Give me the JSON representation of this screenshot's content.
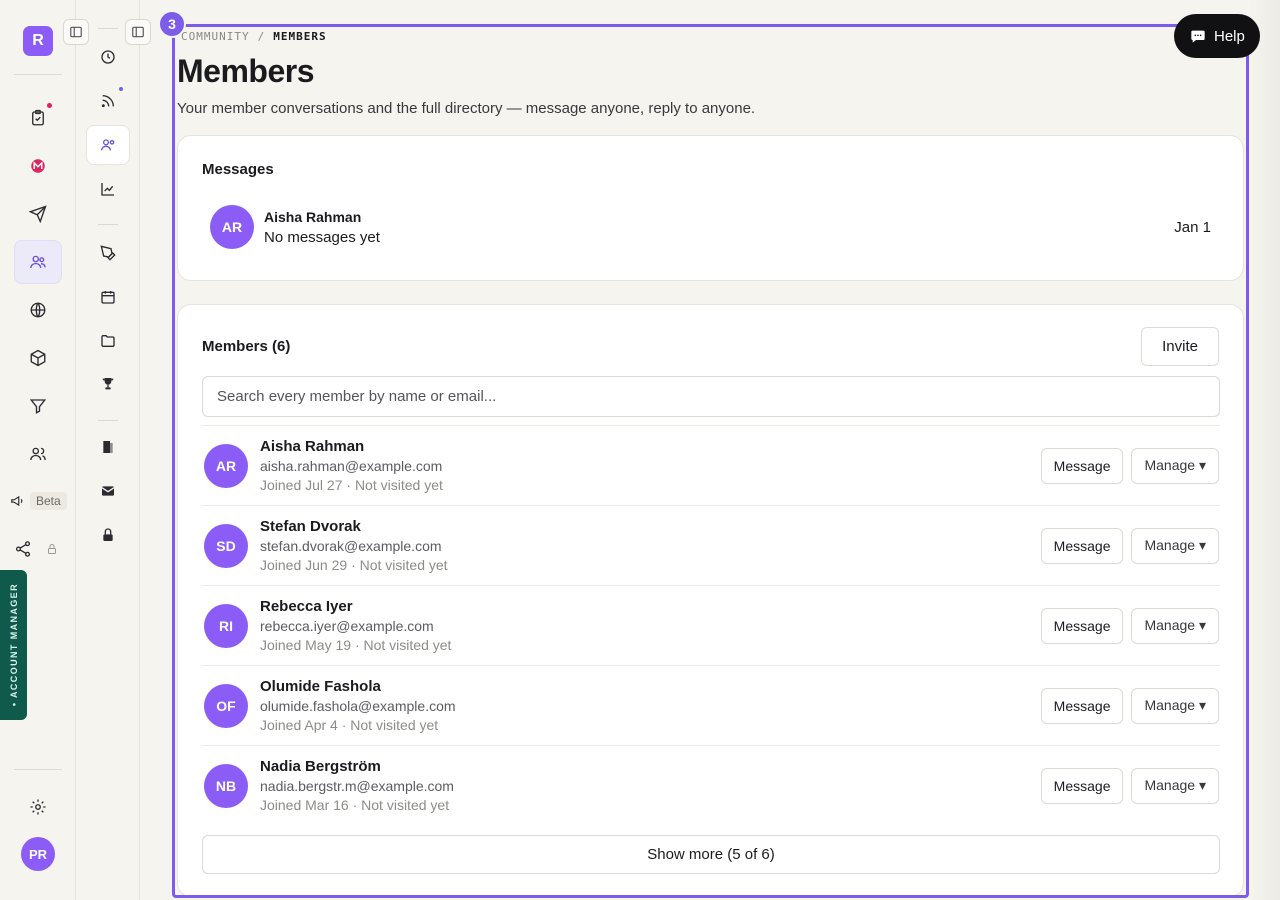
{
  "rail": {
    "logo": "R",
    "beta_label": "Beta",
    "account_manager": "• ACCOUNT MANAGER",
    "user_initials": "PR"
  },
  "breadcrumb": {
    "parent": "COMMUNITY",
    "separator": "/",
    "current": "MEMBERS"
  },
  "page": {
    "title": "Members",
    "subtitle": "Your member conversations and the full directory — message anyone, reply to anyone."
  },
  "step_badge": "3",
  "help": {
    "label": "Help"
  },
  "messages": {
    "title": "Messages",
    "items": [
      {
        "initials": "AR",
        "name": "Aisha Rahman",
        "preview": "No messages yet",
        "date": "Jan 1"
      }
    ]
  },
  "members": {
    "title": "Members (6)",
    "invite_label": "Invite",
    "search_placeholder": "Search every member by name or email...",
    "message_label": "Message",
    "manage_label": "Manage ▾",
    "show_more_label": "Show more (5 of 6)",
    "rows": [
      {
        "initials": "AR",
        "name": "Aisha Rahman",
        "email": "aisha.rahman@example.com",
        "meta": "Joined Jul 27 · Not visited yet"
      },
      {
        "initials": "SD",
        "name": "Stefan Dvorak",
        "email": "stefan.dvorak@example.com",
        "meta": "Joined Jun 29 · Not visited yet"
      },
      {
        "initials": "RI",
        "name": "Rebecca Iyer",
        "email": "rebecca.iyer@example.com",
        "meta": "Joined May 19 · Not visited yet"
      },
      {
        "initials": "OF",
        "name": "Olumide Fashola",
        "email": "olumide.fashola@example.com",
        "meta": "Joined Apr 4 · Not visited yet"
      },
      {
        "initials": "NB",
        "name": "Nadia Bergström",
        "email": "nadia.bergstr.m@example.com",
        "meta": "Joined Mar 16 · Not visited yet"
      }
    ]
  },
  "colors": {
    "accent": "#8b5cf6",
    "highlight_border": "#7c5ce8",
    "account_manager_bg": "#0f5a4a"
  }
}
